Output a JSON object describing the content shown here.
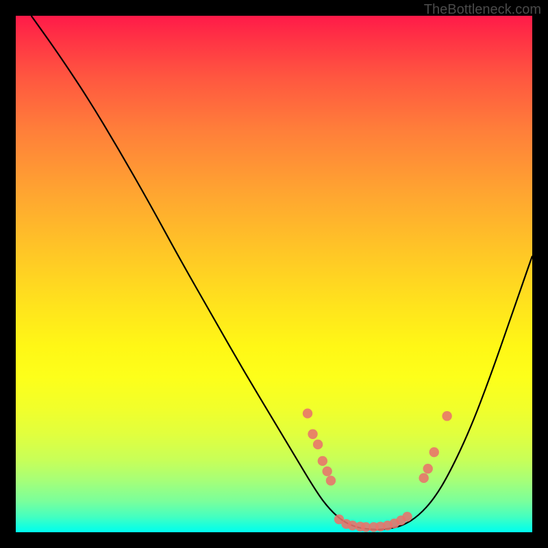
{
  "watermark": "TheBottleneck.com",
  "chart_data": {
    "type": "line",
    "title": "",
    "xlabel": "",
    "ylabel": "",
    "xlim": [
      0,
      100
    ],
    "ylim": [
      0,
      100
    ],
    "curve": [
      {
        "x": 3.0,
        "y": 100.0
      },
      {
        "x": 8.0,
        "y": 93.0
      },
      {
        "x": 14.0,
        "y": 84.0
      },
      {
        "x": 20.0,
        "y": 74.0
      },
      {
        "x": 26.0,
        "y": 63.5
      },
      {
        "x": 32.0,
        "y": 52.5
      },
      {
        "x": 38.0,
        "y": 42.0
      },
      {
        "x": 44.0,
        "y": 31.5
      },
      {
        "x": 50.0,
        "y": 21.5
      },
      {
        "x": 54.5,
        "y": 14.0
      },
      {
        "x": 57.5,
        "y": 9.0
      },
      {
        "x": 60.0,
        "y": 5.3
      },
      {
        "x": 63.0,
        "y": 2.3
      },
      {
        "x": 66.0,
        "y": 0.9
      },
      {
        "x": 69.0,
        "y": 0.5
      },
      {
        "x": 72.0,
        "y": 0.6
      },
      {
        "x": 75.0,
        "y": 1.3
      },
      {
        "x": 78.0,
        "y": 3.2
      },
      {
        "x": 81.0,
        "y": 6.5
      },
      {
        "x": 84.0,
        "y": 11.5
      },
      {
        "x": 88.0,
        "y": 20.0
      },
      {
        "x": 92.0,
        "y": 30.5
      },
      {
        "x": 96.0,
        "y": 42.0
      },
      {
        "x": 100.0,
        "y": 53.5
      }
    ],
    "series": [
      {
        "name": "points",
        "type": "scatter",
        "color": "#e8736b",
        "values": [
          {
            "x": 56.5,
            "y": 23.0
          },
          {
            "x": 57.5,
            "y": 19.0
          },
          {
            "x": 58.5,
            "y": 17.0
          },
          {
            "x": 59.4,
            "y": 13.8
          },
          {
            "x": 60.3,
            "y": 11.8
          },
          {
            "x": 61.0,
            "y": 10.0
          },
          {
            "x": 62.6,
            "y": 2.5
          },
          {
            "x": 64.0,
            "y": 1.6
          },
          {
            "x": 65.2,
            "y": 1.3
          },
          {
            "x": 66.7,
            "y": 1.1
          },
          {
            "x": 67.8,
            "y": 1.0
          },
          {
            "x": 69.3,
            "y": 1.0
          },
          {
            "x": 70.6,
            "y": 1.1
          },
          {
            "x": 72.0,
            "y": 1.3
          },
          {
            "x": 73.3,
            "y": 1.7
          },
          {
            "x": 74.6,
            "y": 2.3
          },
          {
            "x": 75.8,
            "y": 3.0
          },
          {
            "x": 79.0,
            "y": 10.5
          },
          {
            "x": 79.8,
            "y": 12.3
          },
          {
            "x": 81.0,
            "y": 15.5
          },
          {
            "x": 83.5,
            "y": 22.5
          }
        ]
      }
    ]
  }
}
